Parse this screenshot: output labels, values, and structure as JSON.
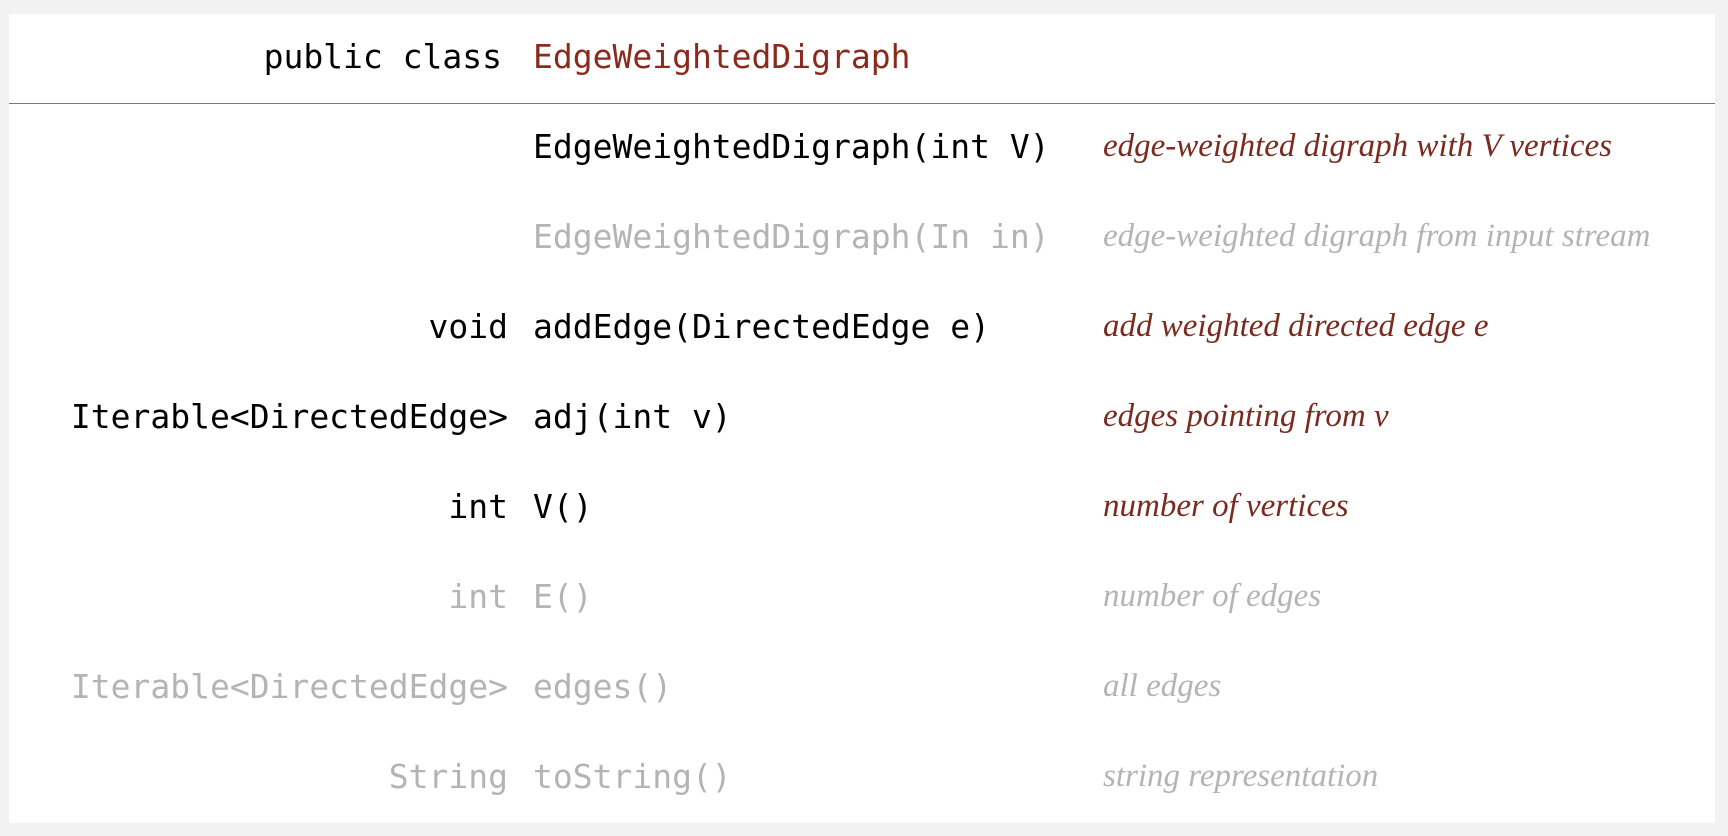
{
  "header": {
    "keyword": "public class",
    "class_name": "EdgeWeightedDigraph"
  },
  "colors": {
    "accent": "#8b2a1c",
    "text": "#000000",
    "muted": "#b4b4b4",
    "background": "#f2f2f2",
    "panel": "#ffffff"
  },
  "rows": [
    {
      "type": "",
      "signature": "EdgeWeightedDigraph(int V)",
      "description": "edge-weighted digraph with V vertices",
      "active": true
    },
    {
      "type": "",
      "signature": "EdgeWeightedDigraph(In in)",
      "description": "edge-weighted digraph from input stream",
      "active": false
    },
    {
      "type": "void",
      "signature": "addEdge(DirectedEdge e)",
      "description": "add weighted directed edge e",
      "active": true
    },
    {
      "type": "Iterable<DirectedEdge>",
      "signature": "adj(int v)",
      "description": "edges pointing from v",
      "active": true
    },
    {
      "type": "int",
      "signature": "V()",
      "description": "number of vertices",
      "active": true
    },
    {
      "type": "int",
      "signature": "E()",
      "description": "number of edges",
      "active": false
    },
    {
      "type": "Iterable<DirectedEdge>",
      "signature": "edges()",
      "description": "all edges",
      "active": false
    },
    {
      "type": "String",
      "signature": "toString()",
      "description": "string representation",
      "active": false
    }
  ]
}
